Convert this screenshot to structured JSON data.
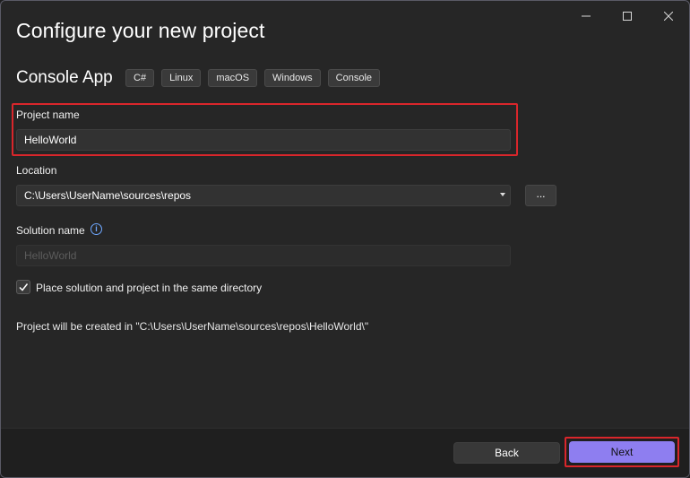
{
  "dialog": {
    "title": "Configure your new project",
    "template_name": "Console App",
    "tags": [
      "C#",
      "Linux",
      "macOS",
      "Windows",
      "Console"
    ]
  },
  "window_controls": {
    "minimize_icon": "minimize-icon",
    "maximize_icon": "maximize-icon",
    "close_icon": "close-icon"
  },
  "form": {
    "project_name": {
      "label": "Project name",
      "value": "HelloWorld"
    },
    "location": {
      "label": "Location",
      "value": "C:\\Users\\UserName\\sources\\repos",
      "browse_label": "..."
    },
    "solution_name": {
      "label": "Solution name",
      "value": "HelloWorld",
      "info_icon": "info-icon"
    },
    "same_directory": {
      "label": "Place solution and project in the same directory",
      "checked": true
    },
    "created_path_text": "Project will be created in \"C:\\Users\\UserName\\sources\\repos\\HelloWorld\\\""
  },
  "footer": {
    "back_label": "Back",
    "next_label": "Next"
  },
  "colors": {
    "accent": "#8e7ef0",
    "highlight": "#d9262b",
    "background": "#262626"
  }
}
